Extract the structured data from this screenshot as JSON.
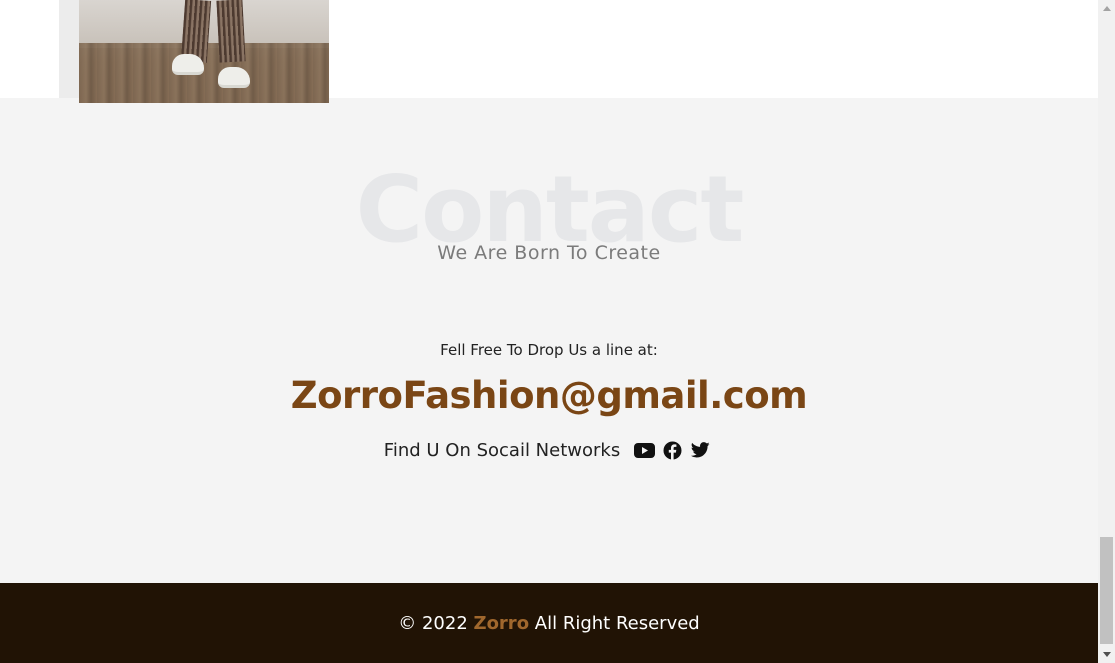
{
  "contact": {
    "background_word": "Contact",
    "subtitle": "We Are Born To Create",
    "drop_line": "Fell Free To Drop Us a line at:",
    "email": "ZorroFashion@gmail.com",
    "social_label": "Find U On Socail Networks",
    "social_icons": [
      "youtube-icon",
      "facebook-icon",
      "twitter-icon"
    ]
  },
  "footer": {
    "copyright_prefix": "© 2022",
    "brand": "Zorro",
    "copyright_suffix": "All Right Reserved"
  },
  "colors": {
    "accent": "#7a4615",
    "brand_footer": "#a0672d",
    "footer_bg": "#211305",
    "section_bg": "#f4f4f4"
  }
}
